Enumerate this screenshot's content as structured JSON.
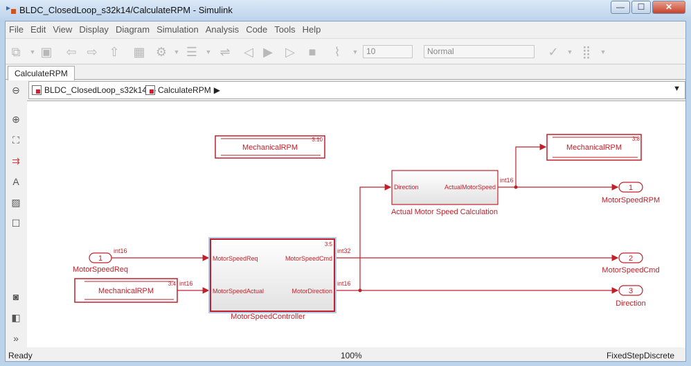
{
  "window": {
    "title": "BLDC_ClosedLoop_s32k14/CalculateRPM - Simulink",
    "minimize": "—",
    "maximize": "☐",
    "close": "✕"
  },
  "menu": [
    "File",
    "Edit",
    "View",
    "Display",
    "Diagram",
    "Simulation",
    "Analysis",
    "Code",
    "Tools",
    "Help"
  ],
  "toolbar": {
    "stop_time": "10",
    "sim_mode": "Normal"
  },
  "tab": "CalculateRPM",
  "breadcrumb": [
    "BLDC_ClosedLoop_s32k14",
    "CalculateRPM"
  ],
  "diagram": {
    "blocks": {
      "mech_top": {
        "label": "MechanicalRPM",
        "tag": "3:10"
      },
      "mech_right": {
        "label": "MechanicalRPM",
        "tag": "3:8"
      },
      "mech_left": {
        "label": "MechanicalRPM",
        "tag": "3:4"
      },
      "actual": {
        "name": "Actual Motor Speed Calculation",
        "in": "Direction",
        "out": "ActualMotorSpeed"
      },
      "controller": {
        "name": "MotorSpeedController",
        "tag": "3:5",
        "in1": "MotorSpeedReq",
        "in2": "MotorSpeedActual",
        "out1": "MotorSpeedCmd",
        "out2": "MotorDirection"
      },
      "inport1": {
        "num": "1",
        "name": "MotorSpeedReq"
      },
      "outport1": {
        "num": "1",
        "name": "MotorSpeedRPM"
      },
      "outport2": {
        "num": "2",
        "name": "MotorSpeedCmd"
      },
      "outport3": {
        "num": "3",
        "name": "Direction"
      }
    },
    "signals": {
      "in_req": "int16",
      "in_actual": "int16",
      "cmd": "int32",
      "dir": "int16",
      "rpm": "int16"
    },
    "color": "#c0202a"
  },
  "status": {
    "left": "Ready",
    "zoom": "100%",
    "solver": "FixedStepDiscrete"
  }
}
